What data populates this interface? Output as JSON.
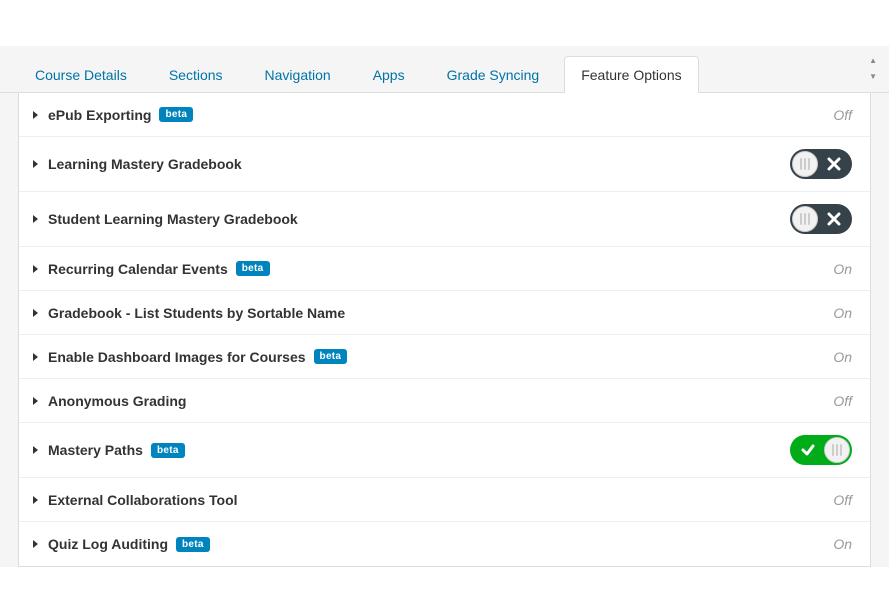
{
  "tabs": {
    "items": [
      {
        "label": "Course Details",
        "active": false
      },
      {
        "label": "Sections",
        "active": false
      },
      {
        "label": "Navigation",
        "active": false
      },
      {
        "label": "Apps",
        "active": false
      },
      {
        "label": "Grade Syncing",
        "active": false
      },
      {
        "label": "Feature Options",
        "active": true
      }
    ]
  },
  "badges": {
    "beta": "beta"
  },
  "features": [
    {
      "title": "ePub Exporting",
      "beta": true,
      "state": "Off",
      "control": "text"
    },
    {
      "title": "Learning Mastery Gradebook",
      "beta": false,
      "state": "off",
      "control": "toggle-off"
    },
    {
      "title": "Student Learning Mastery Gradebook",
      "beta": false,
      "state": "off",
      "control": "toggle-off"
    },
    {
      "title": "Recurring Calendar Events",
      "beta": true,
      "state": "On",
      "control": "text"
    },
    {
      "title": "Gradebook - List Students by Sortable Name",
      "beta": false,
      "state": "On",
      "control": "text"
    },
    {
      "title": "Enable Dashboard Images for Courses",
      "beta": true,
      "state": "On",
      "control": "text"
    },
    {
      "title": "Anonymous Grading",
      "beta": false,
      "state": "Off",
      "control": "text"
    },
    {
      "title": "Mastery Paths",
      "beta": true,
      "state": "on",
      "control": "toggle-on"
    },
    {
      "title": "External Collaborations Tool",
      "beta": false,
      "state": "Off",
      "control": "text"
    },
    {
      "title": "Quiz Log Auditing",
      "beta": true,
      "state": "On",
      "control": "text"
    }
  ],
  "annotation": {
    "color": "#d81f1f",
    "target": "Feature Options"
  }
}
